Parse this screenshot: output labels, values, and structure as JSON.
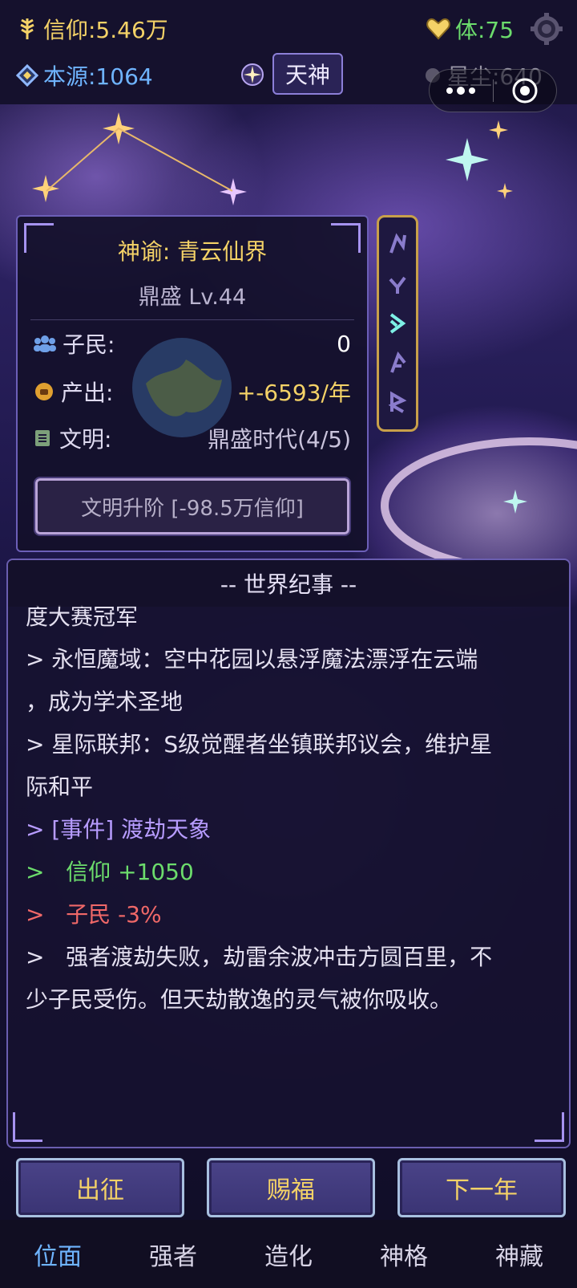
{
  "header": {
    "faith": "信仰:5.46万",
    "stamina": "体:75",
    "source": "本源:1064",
    "rank": "天神",
    "stardust": "星尘:640"
  },
  "planet": {
    "title": "神谕: 青云仙界",
    "level": "鼎盛  Lv.44",
    "rows": [
      {
        "label": "子民:",
        "value": "0",
        "icon": "people-icon",
        "color": "#ffffff"
      },
      {
        "label": "产出:",
        "value": "+-6593/年",
        "icon": "coin-icon",
        "color": "#f4d267"
      },
      {
        "label": "文明:",
        "value": "鼎盛时代(4/5)",
        "icon": "book-icon",
        "color": "#c9c3dc"
      }
    ],
    "upgrade_button": "文明升阶 [-98.5万信仰]"
  },
  "chronicle": {
    "title": "-- 世界纪事 --",
    "lines": [
      {
        "text": "度大赛冠军",
        "color": "#e4e0f0"
      },
      {
        "text": "> 永恒魔域：空中花园以悬浮魔法漂浮在云端",
        "color": "#e4e0f0"
      },
      {
        "text": "，成为学术圣地",
        "color": "#e4e0f0"
      },
      {
        "text": "> 星际联邦：S级觉醒者坐镇联邦议会，维护星",
        "color": "#e4e0f0"
      },
      {
        "text": "际和平",
        "color": "#e4e0f0"
      },
      {
        "text": "> [事件] 渡劫天象",
        "color": "#b79cff"
      },
      {
        "text": ">   信仰 +1050",
        "color": "#6cdc6c"
      },
      {
        "text": ">   子民 -3%",
        "color": "#f06868"
      },
      {
        "text": ">   强者渡劫失败，劫雷余波冲击方圆百里，不",
        "color": "#e4e0f0"
      },
      {
        "text": "少子民受伤。但天劫散逸的灵气被你吸收。",
        "color": "#e4e0f0"
      }
    ]
  },
  "actions": {
    "expedition": "出征",
    "bless": "赐福",
    "next_year": "下一年"
  },
  "nav": {
    "tabs": [
      "位面",
      "强者",
      "造化",
      "神格",
      "神藏"
    ],
    "active_index": 0
  },
  "colors": {
    "gold": "#f4d267",
    "blue": "#6fb4ff",
    "green": "#6cdc6c",
    "red": "#f06868",
    "purple": "#b79cff"
  }
}
